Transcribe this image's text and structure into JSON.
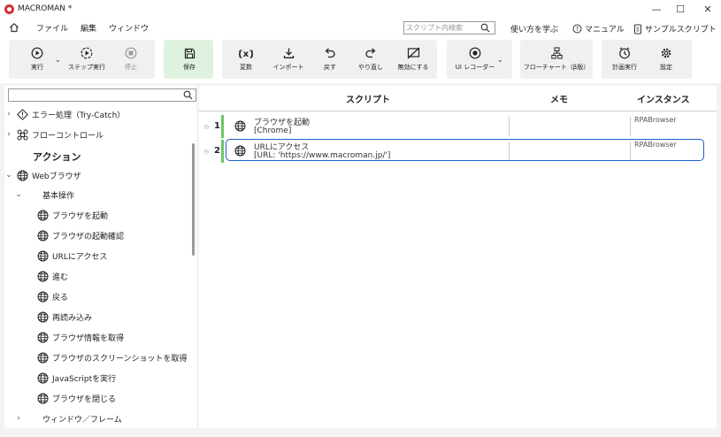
{
  "window": {
    "title": "MACROMAN *",
    "minimize": "—",
    "maximize": "☐",
    "close": "✕"
  },
  "menu": {
    "items": [
      "ファイル",
      "編集",
      "ウィンドウ"
    ]
  },
  "search": {
    "placeholder": "スクリプト内検索"
  },
  "help": {
    "learn": "使い方を学ぶ",
    "manual": "マニュアル",
    "samples": "サンプルスクリプト"
  },
  "toolbar": {
    "run": "実行",
    "step_run": "ステップ実行",
    "stop": "停止",
    "save": "保存",
    "variables": "変数",
    "import": "インポート",
    "undo": "戻す",
    "redo": "やり直し",
    "disable": "無効にする",
    "ui_recorder": "UI レコーダー",
    "flowchart": "フローチャート（β版）",
    "schedule": "計画実行",
    "settings": "設定"
  },
  "tree": {
    "error_handling": "エラー処理（Try-Catch）",
    "flow_control": "フローコントロール",
    "actions_heading": "アクション",
    "web_browser": "Webブラウザ",
    "basic_ops": "基本操作",
    "items": [
      "ブラウザを起動",
      "ブラウザの起動確認",
      "URLにアクセス",
      "進む",
      "戻る",
      "再読み込み",
      "ブラウザ情報を取得",
      "ブラウザのスクリーンショットを取得",
      "JavaScriptを実行",
      "ブラウザを閉じる"
    ],
    "window_frame": "ウィンドウ／フレーム"
  },
  "columns": {
    "script": "スクリプト",
    "memo": "メモ",
    "instance": "インスタンス"
  },
  "steps": [
    {
      "num": "1",
      "title": "ブラウザを起動",
      "param": "[Chrome]",
      "instance": "RPABrowser"
    },
    {
      "num": "2",
      "title": "URLにアクセス",
      "param": "[URL: 'https://www.macroman.jp/']",
      "instance": "RPABrowser"
    }
  ],
  "colors": {
    "accent": "#1a5fd0",
    "save_bg": "#dff2df",
    "step_bar": "#6cc46c"
  }
}
